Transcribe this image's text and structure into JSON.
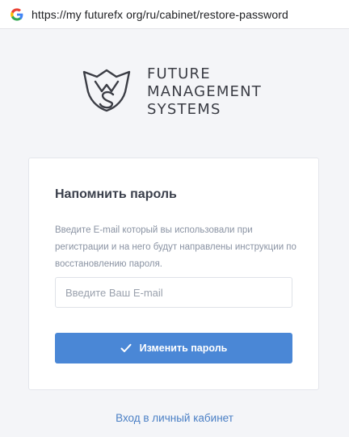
{
  "browser": {
    "url": "https://my futurefx org/ru/cabinet/restore-password",
    "favicon": "google-g-icon"
  },
  "logo": {
    "mark_icon": "fms-monogram-icon",
    "line1": "FUTURE",
    "line2": "MANAGEMENT",
    "line3": "SYSTEMS"
  },
  "form": {
    "title": "Напомнить пароль",
    "description": "Введите E-mail который вы использовали при регистрации и на него будут направлены инструкции по восстановлению пароля.",
    "email_value": "",
    "email_placeholder": "Введите Ваш E-mail",
    "submit_label": "Изменить пароль",
    "submit_icon": "check-icon"
  },
  "footer": {
    "login_link": "Вход в личный кабинет"
  },
  "colors": {
    "accent": "#4a87d6",
    "link": "#4a7fc5",
    "background": "#f4f5f8"
  }
}
